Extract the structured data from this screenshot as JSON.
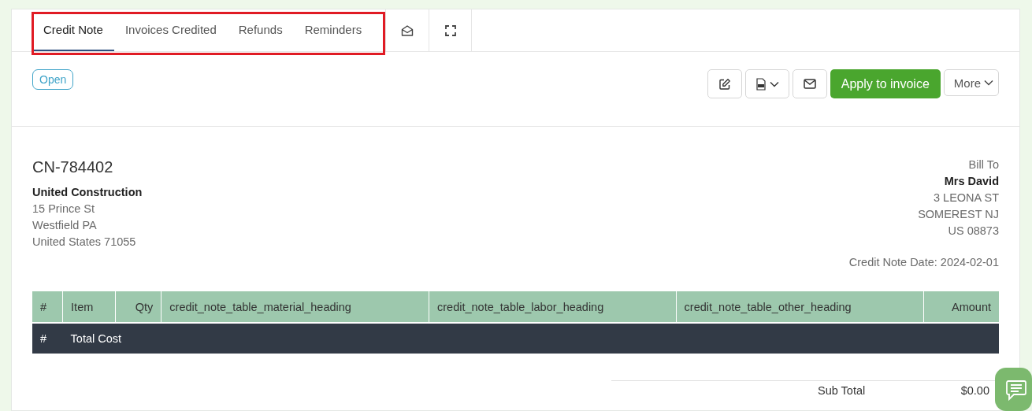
{
  "tabs": [
    {
      "label": "Credit Note",
      "selected": true
    },
    {
      "label": "Invoices Credited",
      "selected": false
    },
    {
      "label": "Refunds",
      "selected": false
    },
    {
      "label": "Reminders",
      "selected": false
    }
  ],
  "highlight": true,
  "status": "Open",
  "actions": {
    "primary": "Apply to invoice",
    "more": "More"
  },
  "credit_note": {
    "number": "CN-784402",
    "company": "United Construction",
    "address": [
      "15 Prince St",
      "Westfield PA",
      "United States 71055"
    ]
  },
  "bill_to": {
    "label": "Bill To",
    "name": "Mrs David",
    "address": [
      "3 LEONA ST",
      "SOMEREST NJ",
      "US 08873"
    ],
    "date": "Credit Note Date: 2024-02-01"
  },
  "table": {
    "columns": [
      "#",
      "Item",
      "Qty",
      "credit_note_table_material_heading",
      "credit_note_table_labor_heading",
      "credit_note_table_other_heading",
      "Amount"
    ],
    "total_row": [
      "#",
      "Total Cost"
    ]
  },
  "totals": [
    {
      "label": "Sub Total",
      "value": "$0.00"
    }
  ]
}
